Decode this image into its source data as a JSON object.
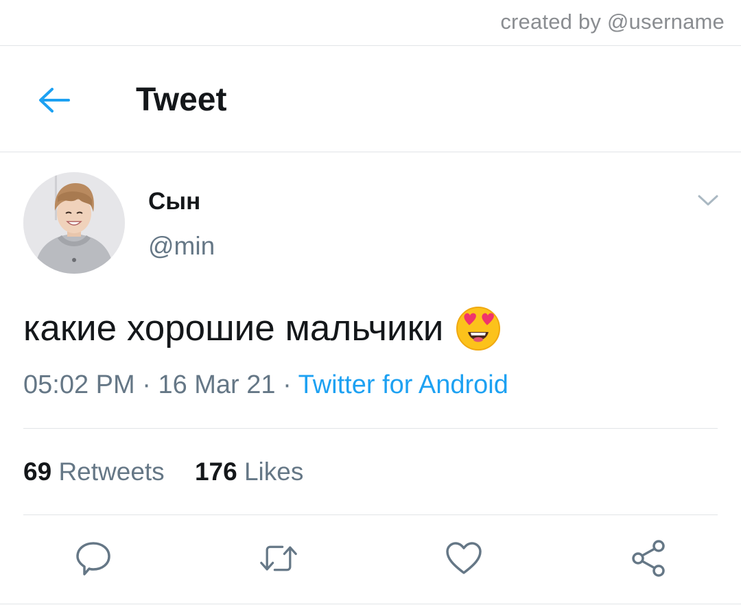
{
  "watermark": {
    "text": "created by @username"
  },
  "appbar": {
    "title": "Tweet",
    "back_icon": "arrow-left-icon",
    "accent_color": "#1da1f2"
  },
  "tweet": {
    "author": {
      "display_name": "Сын",
      "handle": "@min",
      "avatar": "avatar-photo"
    },
    "text": "какие хорошие мальчики",
    "emoji": "smiling-face-with-heart-eyes",
    "time": "05:02 PM",
    "separator": "·",
    "date": "16 Mar 21",
    "source": "Twitter for Android",
    "stats": {
      "retweets_count": "69",
      "retweets_label": "Retweets",
      "likes_count": "176",
      "likes_label": "Likes"
    },
    "actions": [
      "reply-icon",
      "retweet-icon",
      "like-icon",
      "share-icon"
    ]
  },
  "colors": {
    "text_primary": "#14171a",
    "text_secondary": "#657786",
    "divider": "#e1e4e7",
    "link": "#1da1f2"
  }
}
